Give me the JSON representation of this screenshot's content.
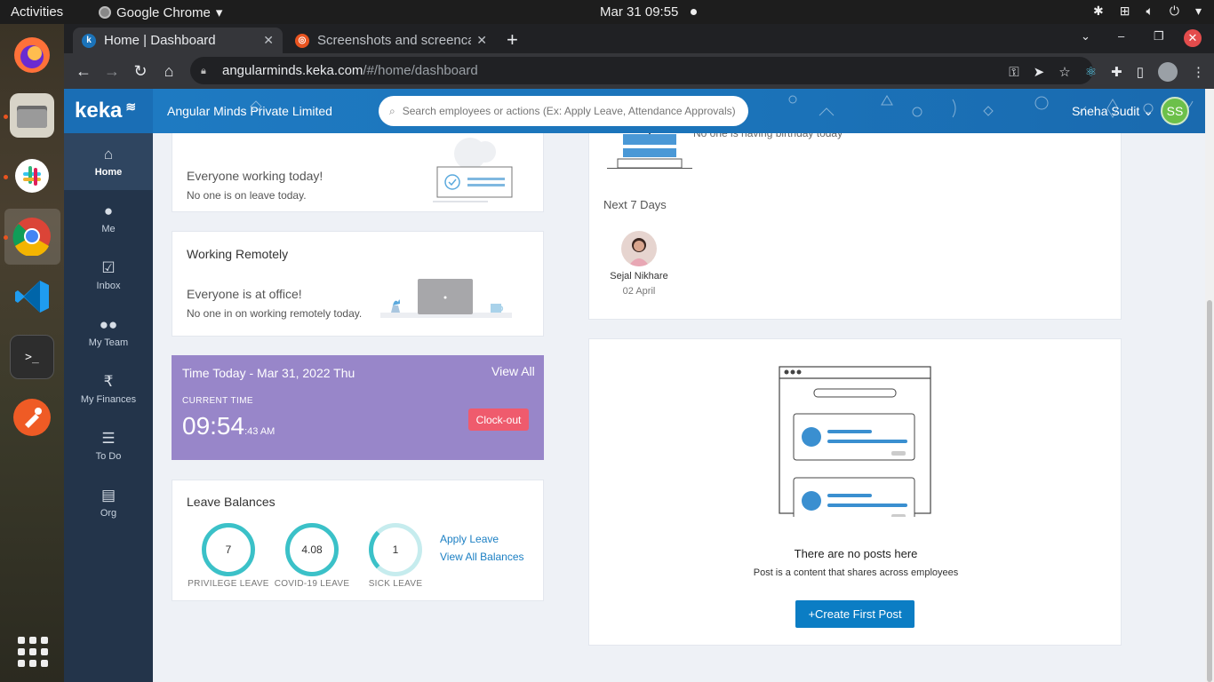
{
  "system": {
    "activities": "Activities",
    "app_name": "Google Chrome",
    "clock": "Mar 31  09:55"
  },
  "chrome": {
    "tabs": [
      {
        "title": "Home | Dashboard",
        "favicon": "k"
      },
      {
        "title": "Screenshots and screencasts",
        "favicon": "u"
      }
    ],
    "url_host": "angularminds.keka.com",
    "url_path": "/#/home/dashboard"
  },
  "keka": {
    "logo": "keka",
    "company": "Angular Minds Private Limited",
    "search_placeholder": "Search employees or actions (Ex: Apply Leave, Attendance Approvals)",
    "user_name": "Sneha Sudit",
    "user_initials": "SS",
    "accent": "#1b73b9",
    "sidebar": [
      {
        "label": "Home",
        "icon": "home-icon"
      },
      {
        "label": "Me",
        "icon": "person-icon"
      },
      {
        "label": "Inbox",
        "icon": "inbox-icon"
      },
      {
        "label": "My Team",
        "icon": "team-icon"
      },
      {
        "label": "My Finances",
        "icon": "rupee-icon"
      },
      {
        "label": "To Do",
        "icon": "list-icon"
      },
      {
        "label": "Org",
        "icon": "building-icon"
      }
    ]
  },
  "leave_card": {
    "status": "Everyone working today!",
    "sub": "No one is on leave today."
  },
  "remote_card": {
    "title": "Working Remotely",
    "status": "Everyone is at office!",
    "sub": "No one in on working remotely today."
  },
  "time_card": {
    "title": "Time Today - Mar 31, 2022 Thu",
    "view_all": "View All",
    "current_label": "CURRENT TIME",
    "time_main": "09:54",
    "time_sec": ":43 AM",
    "clockout": "Clock-out",
    "color": "#9886c9"
  },
  "leave_balances": {
    "title": "Leave Balances",
    "items": [
      {
        "value": "7",
        "label": "PRIVILEGE LEAVE"
      },
      {
        "value": "4.08",
        "label": "COVID-19 LEAVE"
      },
      {
        "value": "1",
        "label": "SICK LEAVE"
      }
    ],
    "apply": "Apply Leave",
    "view_all": "View All Balances"
  },
  "birthdays": {
    "today_text": "No one is having birthday today",
    "next_label": "Next 7 Days",
    "person_name": "Sejal Nikhare",
    "person_date": "02 April"
  },
  "posts": {
    "empty_title": "There are no posts here",
    "empty_sub": "Post is a content that shares across employees",
    "create_btn": "+Create First Post"
  }
}
